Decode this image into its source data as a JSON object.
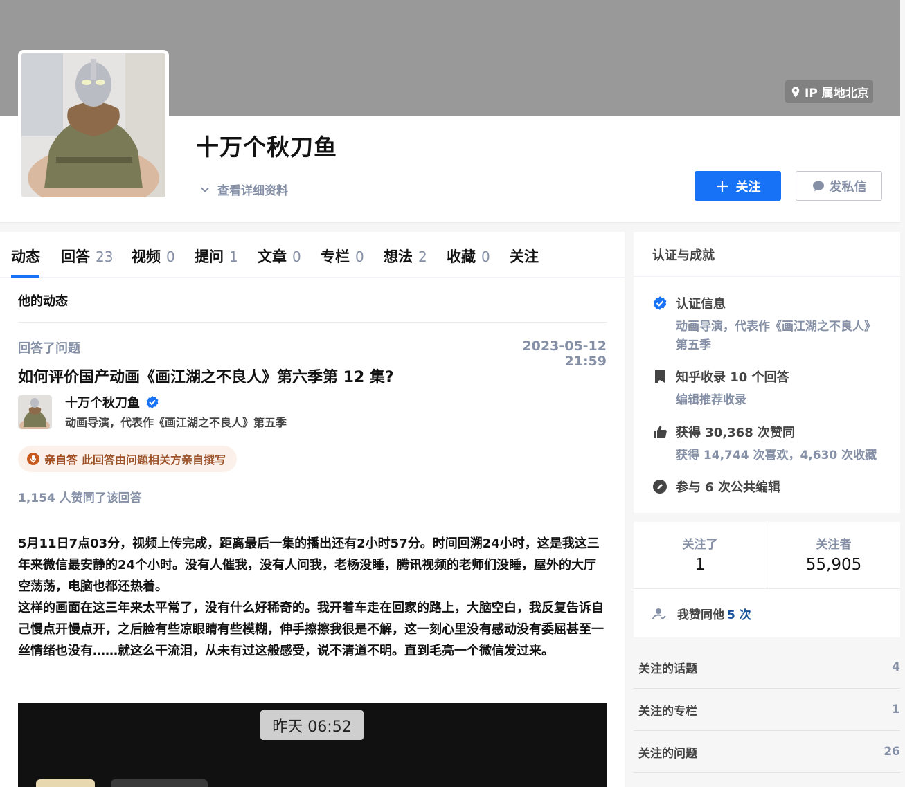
{
  "header": {
    "ip_location": "IP 属地北京",
    "user_name": "十万个秋刀鱼",
    "view_details": "查看详细资料",
    "follow_button": "关注",
    "message_button": "发私信"
  },
  "tabs": [
    {
      "label": "动态",
      "count": ""
    },
    {
      "label": "回答",
      "count": "23"
    },
    {
      "label": "视频",
      "count": "0"
    },
    {
      "label": "提问",
      "count": "1"
    },
    {
      "label": "文章",
      "count": "0"
    },
    {
      "label": "专栏",
      "count": "0"
    },
    {
      "label": "想法",
      "count": "2"
    },
    {
      "label": "收藏",
      "count": "0"
    },
    {
      "label": "关注",
      "count": ""
    }
  ],
  "feed": {
    "section_title": "他的动态",
    "item": {
      "action": "回答了问题",
      "time": "2023-05-12 21:59",
      "question": "如何评价国产动画《画江湖之不良人》第六季第 12 集?",
      "author_name": "十万个秋刀鱼",
      "author_headline": "动画导演，代表作《画江湖之不良人》第五季",
      "self_answer_tag_strong": "亲自答",
      "self_answer_tag_text": "此回答由问题相关方亲自撰写",
      "votes": "1,154 人赞同了该回答",
      "paragraphs": [
        "5月11日7点03分，视频上传完成，距离最后一集的播出还有2小时57分。时间回溯24小时，这是我这三年来微信最安静的24个小时。没有人催我，没有人问我，老杨没睡，腾讯视频的老师们没睡，屋外的大厅空荡荡，电脑也都还热着。",
        "这样的画面在这三年来太平常了，没有什么好稀奇的。我开着车走在回家的路上，大脑空白，我反复告诉自己慢点开慢点开，之后脸有些凉眼睛有些模糊，伸手擦擦我很是不解，这一刻心里没有感动没有委屈甚至一丝情绪也没有……就这么干流泪，从未有过这般感受，说不清道不明。直到毛亮一个微信发过来。"
      ],
      "image_time": "昨天 06:52"
    }
  },
  "achievements": {
    "title": "认证与成就",
    "verify_label": "认证信息",
    "verify_detail": "动画导演，代表作《画江湖之不良人》第五季",
    "collected": "知乎收录 10 个回答",
    "collected_sub": "编辑推荐收录",
    "likes": "获得 30,368 次赞同",
    "likes_sub": "获得 14,744 次喜欢，4,630 次收藏",
    "edits": "参与 6 次公共编辑"
  },
  "follow_stats": {
    "following_label": "关注了",
    "following_value": "1",
    "followers_label": "关注者",
    "followers_value": "55,905",
    "agree_prefix": "我赞同他",
    "agree_count": "5 次"
  },
  "sidebar_links": [
    {
      "label": "关注的话题",
      "value": "4"
    },
    {
      "label": "关注的专栏",
      "value": "1"
    },
    {
      "label": "关注的问题",
      "value": "26"
    }
  ],
  "colors": {
    "primary": "#1772f6",
    "muted": "#8590a6",
    "cover": "#999999",
    "self_answer_bg": "#fbf1ea"
  }
}
